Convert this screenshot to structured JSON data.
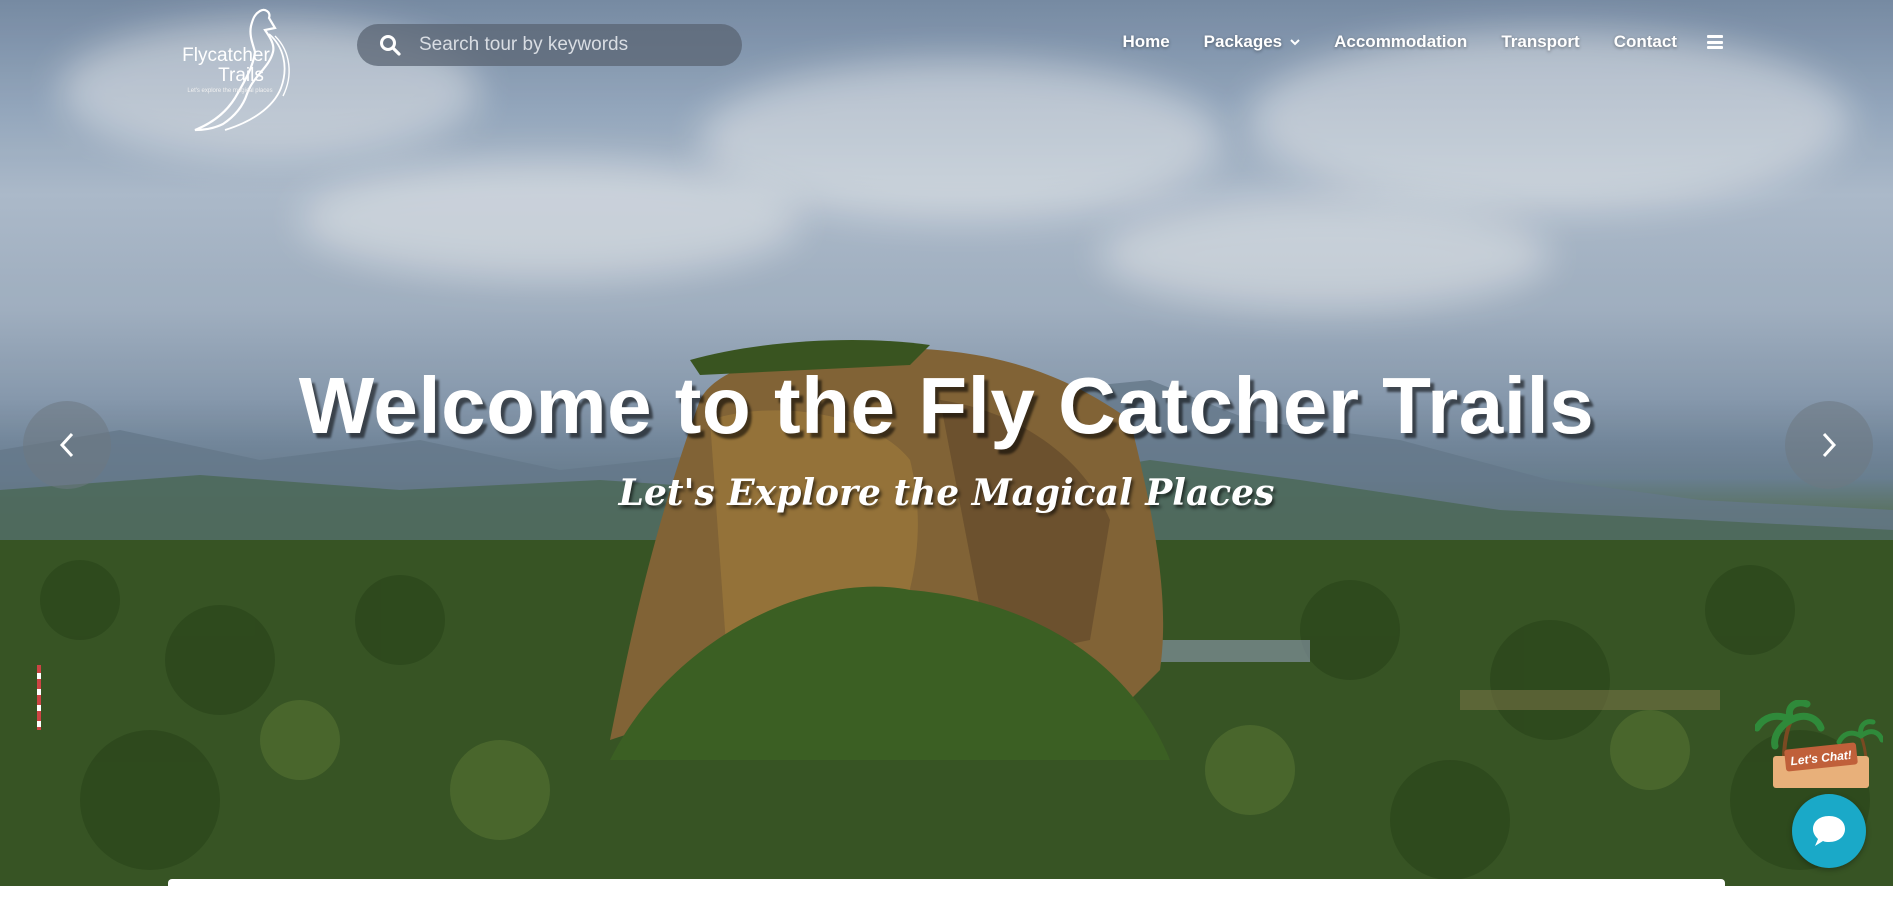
{
  "brand": {
    "name_line1": "Flycatcher",
    "name_line2": "Trails",
    "tagline": "Let's explore the magical places",
    "logo_icon": "flycatcher-bird-icon"
  },
  "search": {
    "placeholder": "Search tour by keywords",
    "icon": "search-icon"
  },
  "nav": {
    "items": [
      {
        "label": "Home"
      },
      {
        "label": "Packages",
        "has_dropdown": true
      },
      {
        "label": "Accommodation"
      },
      {
        "label": "Transport"
      },
      {
        "label": "Contact"
      }
    ],
    "menu_icon": "hamburger-menu-icon"
  },
  "hero": {
    "title": "Welcome to the Fly Catcher Trails",
    "subtitle": "Let's Explore the Magical Places",
    "prev_icon": "chevron-left-icon",
    "next_icon": "chevron-right-icon"
  },
  "chat": {
    "badge_text": "Let's Chat!",
    "icon": "chat-bubble-icon",
    "color": "#1aa9c8"
  }
}
